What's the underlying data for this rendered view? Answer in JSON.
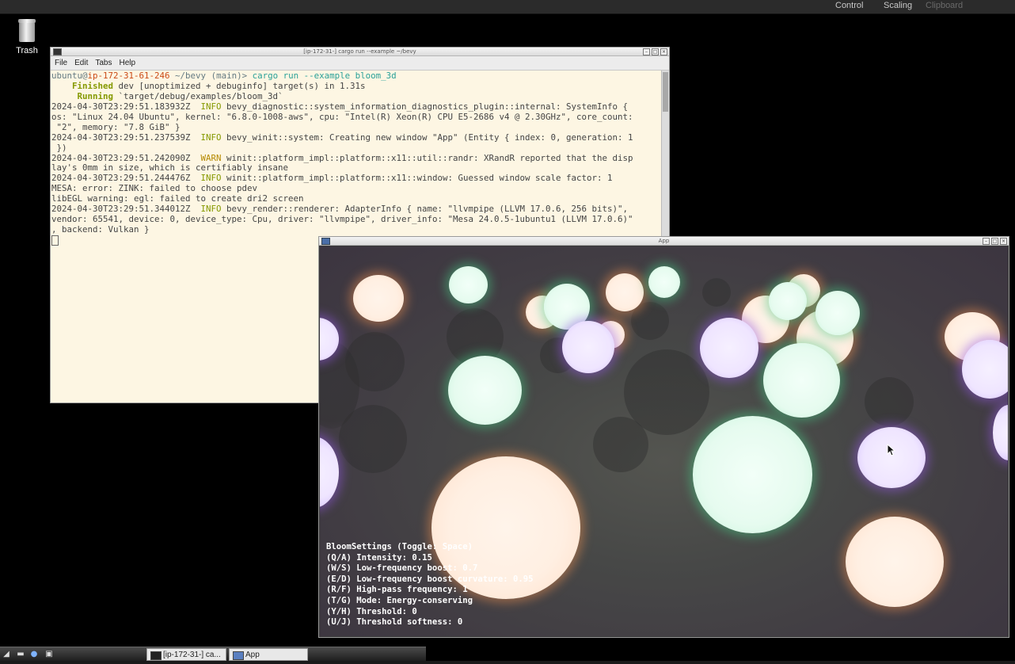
{
  "vnc_bar": {
    "control": "Control",
    "scaling": "Scaling",
    "clipboard": "Clipboard"
  },
  "desktop": {
    "trash_label": "Trash"
  },
  "terminal": {
    "title": "[ip-172-31-] cargo run --example  ~/bevy",
    "menu": [
      "File",
      "Edit",
      "Tabs",
      "Help"
    ],
    "prompt": {
      "user": "ubuntu",
      "at": "@",
      "host": "ip-172-31-61-246",
      "path": " ~/bevy",
      "branch": " (main)",
      "symbol": "> ",
      "command": "cargo run --example bloom_3d"
    },
    "finished": {
      "label": "    Finished",
      "text": " dev [unoptimized + debuginfo] target(s) in 1.31s"
    },
    "running": {
      "label": "     Running",
      "text": " `target/debug/examples/bloom_3d`"
    },
    "log": [
      {
        "ts": "2024-04-30T23:29:51.183932Z",
        "level": "  INFO",
        "msg": " bevy_diagnostic::system_information_diagnostics_plugin::internal: SystemInfo {"
      },
      {
        "ts": "",
        "level": "",
        "msg": "os: \"Linux 24.04 Ubuntu\", kernel: \"6.8.0-1008-aws\", cpu: \"Intel(R) Xeon(R) CPU E5-2686 v4 @ 2.30GHz\", core_count:"
      },
      {
        "ts": "",
        "level": "",
        "msg": " \"2\", memory: \"7.8 GiB\" }"
      },
      {
        "ts": "2024-04-30T23:29:51.237539Z",
        "level": "  INFO",
        "msg": " bevy_winit::system: Creating new window \"App\" (Entity { index: 0, generation: 1"
      },
      {
        "ts": "",
        "level": "",
        "msg": " })"
      },
      {
        "ts": "2024-04-30T23:29:51.242090Z",
        "level": "  WARN",
        "msg": " winit::platform_impl::platform::x11::util::randr: XRandR reported that the disp"
      },
      {
        "ts": "",
        "level": "",
        "msg": "lay's 0mm in size, which is certifiably insane"
      },
      {
        "ts": "2024-04-30T23:29:51.244476Z",
        "level": "  INFO",
        "msg": " winit::platform_impl::platform::x11::window: Guessed window scale factor: 1"
      },
      {
        "ts": "",
        "level": "",
        "msg": "MESA: error: ZINK: failed to choose pdev"
      },
      {
        "ts": "",
        "level": "",
        "msg": "libEGL warning: egl: failed to create dri2 screen"
      },
      {
        "ts": "2024-04-30T23:29:51.344012Z",
        "level": "  INFO",
        "msg": " bevy_render::renderer: AdapterInfo { name: \"llvmpipe (LLVM 17.0.6, 256 bits)\","
      },
      {
        "ts": "",
        "level": "",
        "msg": "vendor: 65541, device: 0, device_type: Cpu, driver: \"llvmpipe\", driver_info: \"Mesa 24.0.5-1ubuntu1 (LLVM 17.0.6)\""
      },
      {
        "ts": "",
        "level": "",
        "msg": ", backend: Vulkan }"
      }
    ]
  },
  "app_window": {
    "title": "App",
    "overlay": [
      "BloomSettings (Toggle: Space)",
      "(Q/A) Intensity: 0.15",
      "(W/S) Low-frequency boost: 0.7",
      "(E/D) Low-frequency boost curvature: 0.95",
      "(R/F) High-pass frequency: 1",
      "(T/G) Mode: Energy-conserving",
      "(Y/H) Threshold: 0",
      "(U/J) Threshold softness: 0"
    ]
  },
  "taskbar": {
    "tasks": [
      "[ip-172-31-] ca...",
      "App"
    ]
  },
  "colors": {
    "terminal_bg": "#fdf6e3",
    "orb_peach": "#ffefe2",
    "orb_mint": "#e6fbef",
    "orb_lavender": "#efe5ff"
  }
}
